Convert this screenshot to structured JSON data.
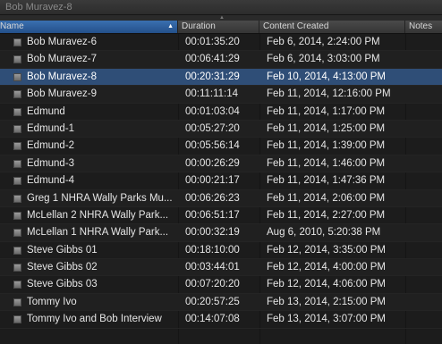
{
  "window": {
    "title": "Bob Muravez-8"
  },
  "columns": {
    "name": "Name",
    "duration": "Duration",
    "content_created": "Content Created",
    "notes": "Notes"
  },
  "rows": [
    {
      "name": "Bob Muravez-6",
      "duration": "00:01:35:20",
      "created": "Feb 6, 2014, 2:24:00 PM"
    },
    {
      "name": "Bob Muravez-7",
      "duration": "00:06:41:29",
      "created": "Feb 6, 2014, 3:03:00 PM"
    },
    {
      "name": "Bob Muravez-8",
      "duration": "00:20:31:29",
      "created": "Feb 10, 2014, 4:13:00 PM",
      "selected": true
    },
    {
      "name": "Bob Muravez-9",
      "duration": "00:11:11:14",
      "created": "Feb 11, 2014, 12:16:00 PM"
    },
    {
      "name": "Edmund",
      "duration": "00:01:03:04",
      "created": "Feb 11, 2014, 1:17:00 PM"
    },
    {
      "name": "Edmund-1",
      "duration": "00:05:27:20",
      "created": "Feb 11, 2014, 1:25:00 PM"
    },
    {
      "name": "Edmund-2",
      "duration": "00:05:56:14",
      "created": "Feb 11, 2014, 1:39:00 PM"
    },
    {
      "name": "Edmund-3",
      "duration": "00:00:26:29",
      "created": "Feb 11, 2014, 1:46:00 PM"
    },
    {
      "name": "Edmund-4",
      "duration": "00:00:21:17",
      "created": "Feb 11, 2014, 1:47:36 PM"
    },
    {
      "name": "Greg 1 NHRA Wally Parks Mu...",
      "duration": "00:06:26:23",
      "created": "Feb 11, 2014, 2:06:00 PM"
    },
    {
      "name": "McLellan  2 NHRA Wally Park...",
      "duration": "00:06:51:17",
      "created": "Feb 11, 2014, 2:27:00 PM"
    },
    {
      "name": "McLellan 1 NHRA Wally Park...",
      "duration": "00:00:32:19",
      "created": "Aug 6, 2010, 5:20:38 PM"
    },
    {
      "name": "Steve Gibbs 01",
      "duration": "00:18:10:00",
      "created": "Feb 12, 2014, 3:35:00 PM"
    },
    {
      "name": "Steve Gibbs 02",
      "duration": "00:03:44:01",
      "created": "Feb 12, 2014, 4:00:00 PM"
    },
    {
      "name": "Steve Gibbs 03",
      "duration": "00:07:20:20",
      "created": "Feb 12, 2014, 4:06:00 PM"
    },
    {
      "name": "Tommy Ivo",
      "duration": "00:20:57:25",
      "created": "Feb 13, 2014, 2:15:00 PM"
    },
    {
      "name": "Tommy Ivo  and Bob Interview",
      "duration": "00:14:07:08",
      "created": "Feb 13, 2014, 3:07:00 PM"
    }
  ]
}
